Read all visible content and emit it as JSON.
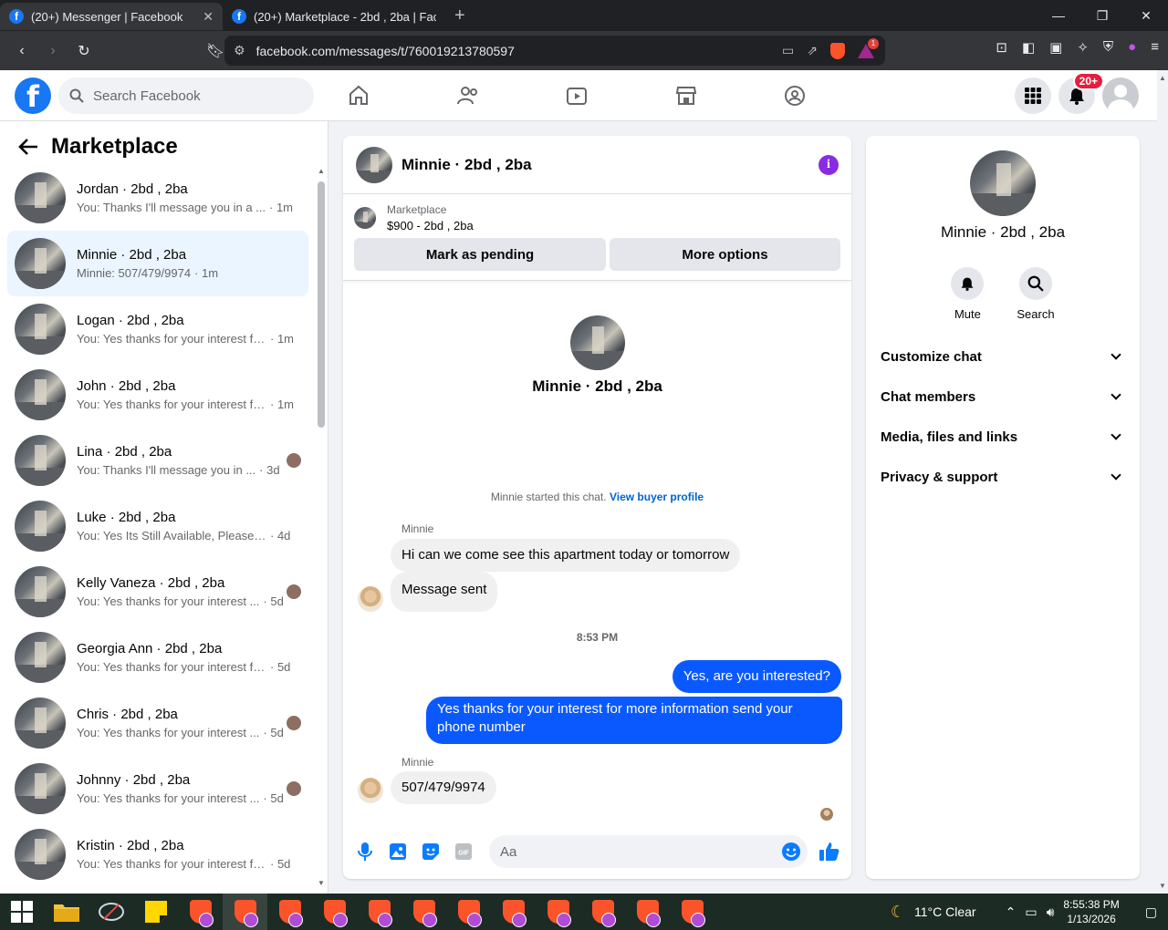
{
  "browser": {
    "tabs": [
      {
        "title": "(20+) Messenger | Facebook",
        "active": true
      },
      {
        "title": "(20+) Marketplace - 2bd , 2ba | Faceb",
        "active": false
      }
    ],
    "url": "facebook.com/messages/t/760019213780597",
    "bat_badge": "1"
  },
  "header": {
    "logo": "f",
    "search_placeholder": "Search Facebook",
    "notif_badge": "20+"
  },
  "sidebar": {
    "title": "Marketplace",
    "conversations": [
      {
        "name": "Jordan · 2bd , 2ba",
        "preview": "You: Thanks I'll message you in a ...",
        "time": "· 1m",
        "seen": false,
        "selected": false
      },
      {
        "name": "Minnie · 2bd , 2ba",
        "preview": "Minnie: 507/479/9974",
        "time": "· 1m",
        "seen": false,
        "selected": true
      },
      {
        "name": "Logan · 2bd , 2ba",
        "preview": "You: Yes thanks for your interest fo...",
        "time": "· 1m",
        "seen": false,
        "selected": false
      },
      {
        "name": "John · 2bd , 2ba",
        "preview": "You: Yes thanks for your interest fo...",
        "time": "· 1m",
        "seen": false,
        "selected": false
      },
      {
        "name": "Lina · 2bd , 2ba",
        "preview": "You: Thanks I'll message you in ...",
        "time": "· 3d",
        "seen": true,
        "selected": false
      },
      {
        "name": "Luke · 2bd , 2ba",
        "preview": "You: Yes Its Still Available, Please Se...",
        "time": "· 4d",
        "seen": false,
        "selected": false
      },
      {
        "name": "Kelly Vaneza · 2bd , 2ba",
        "preview": "You: Yes thanks for your interest ...",
        "time": "· 5d",
        "seen": true,
        "selected": false
      },
      {
        "name": "Georgia Ann · 2bd , 2ba",
        "preview": "You: Yes thanks for your interest for...",
        "time": "· 5d",
        "seen": false,
        "selected": false
      },
      {
        "name": "Chris · 2bd , 2ba",
        "preview": "You: Yes thanks for your interest ...",
        "time": "· 5d",
        "seen": true,
        "selected": false
      },
      {
        "name": "Johnny · 2bd , 2ba",
        "preview": "You: Yes thanks for your interest ...",
        "time": "· 5d",
        "seen": true,
        "selected": false
      },
      {
        "name": "Kristin · 2bd , 2ba",
        "preview": "You: Yes thanks for your interest for...",
        "time": "· 5d",
        "seen": false,
        "selected": false
      }
    ]
  },
  "chat": {
    "title": "Minnie · 2bd , 2ba",
    "marketplace_label": "Marketplace",
    "listing": "$900 - 2bd , 2ba",
    "mark_pending": "Mark as pending",
    "more_options": "More options",
    "profile_name": "Minnie · 2bd , 2ba",
    "started_text": "Minnie started this chat.",
    "view_profile": "View buyer profile",
    "sender1": "Minnie",
    "msg1": "Hi can we come see this apartment today or tomorrow",
    "msg2": "Message sent",
    "timestamp": "8:53 PM",
    "out1": "Yes, are you interested?",
    "out2": "Yes thanks for your interest for more information send your phone number",
    "sender2": "Minnie",
    "msg3": "507/479/9974",
    "input_placeholder": "Aa",
    "gif_label": "GIF"
  },
  "panel": {
    "name": "Minnie · 2bd , 2ba",
    "mute": "Mute",
    "search": "Search",
    "menu": [
      "Customize chat",
      "Chat members",
      "Media, files and links",
      "Privacy & support"
    ]
  },
  "taskbar": {
    "weather": "11°C  Clear",
    "time": "8:55:38 PM",
    "date": "1/13/2026"
  },
  "colors": {
    "fb_blue": "#1877f2",
    "outgoing_bubble": "#0a59ff",
    "link": "#0064d1",
    "info_purple": "#8a2be2"
  }
}
